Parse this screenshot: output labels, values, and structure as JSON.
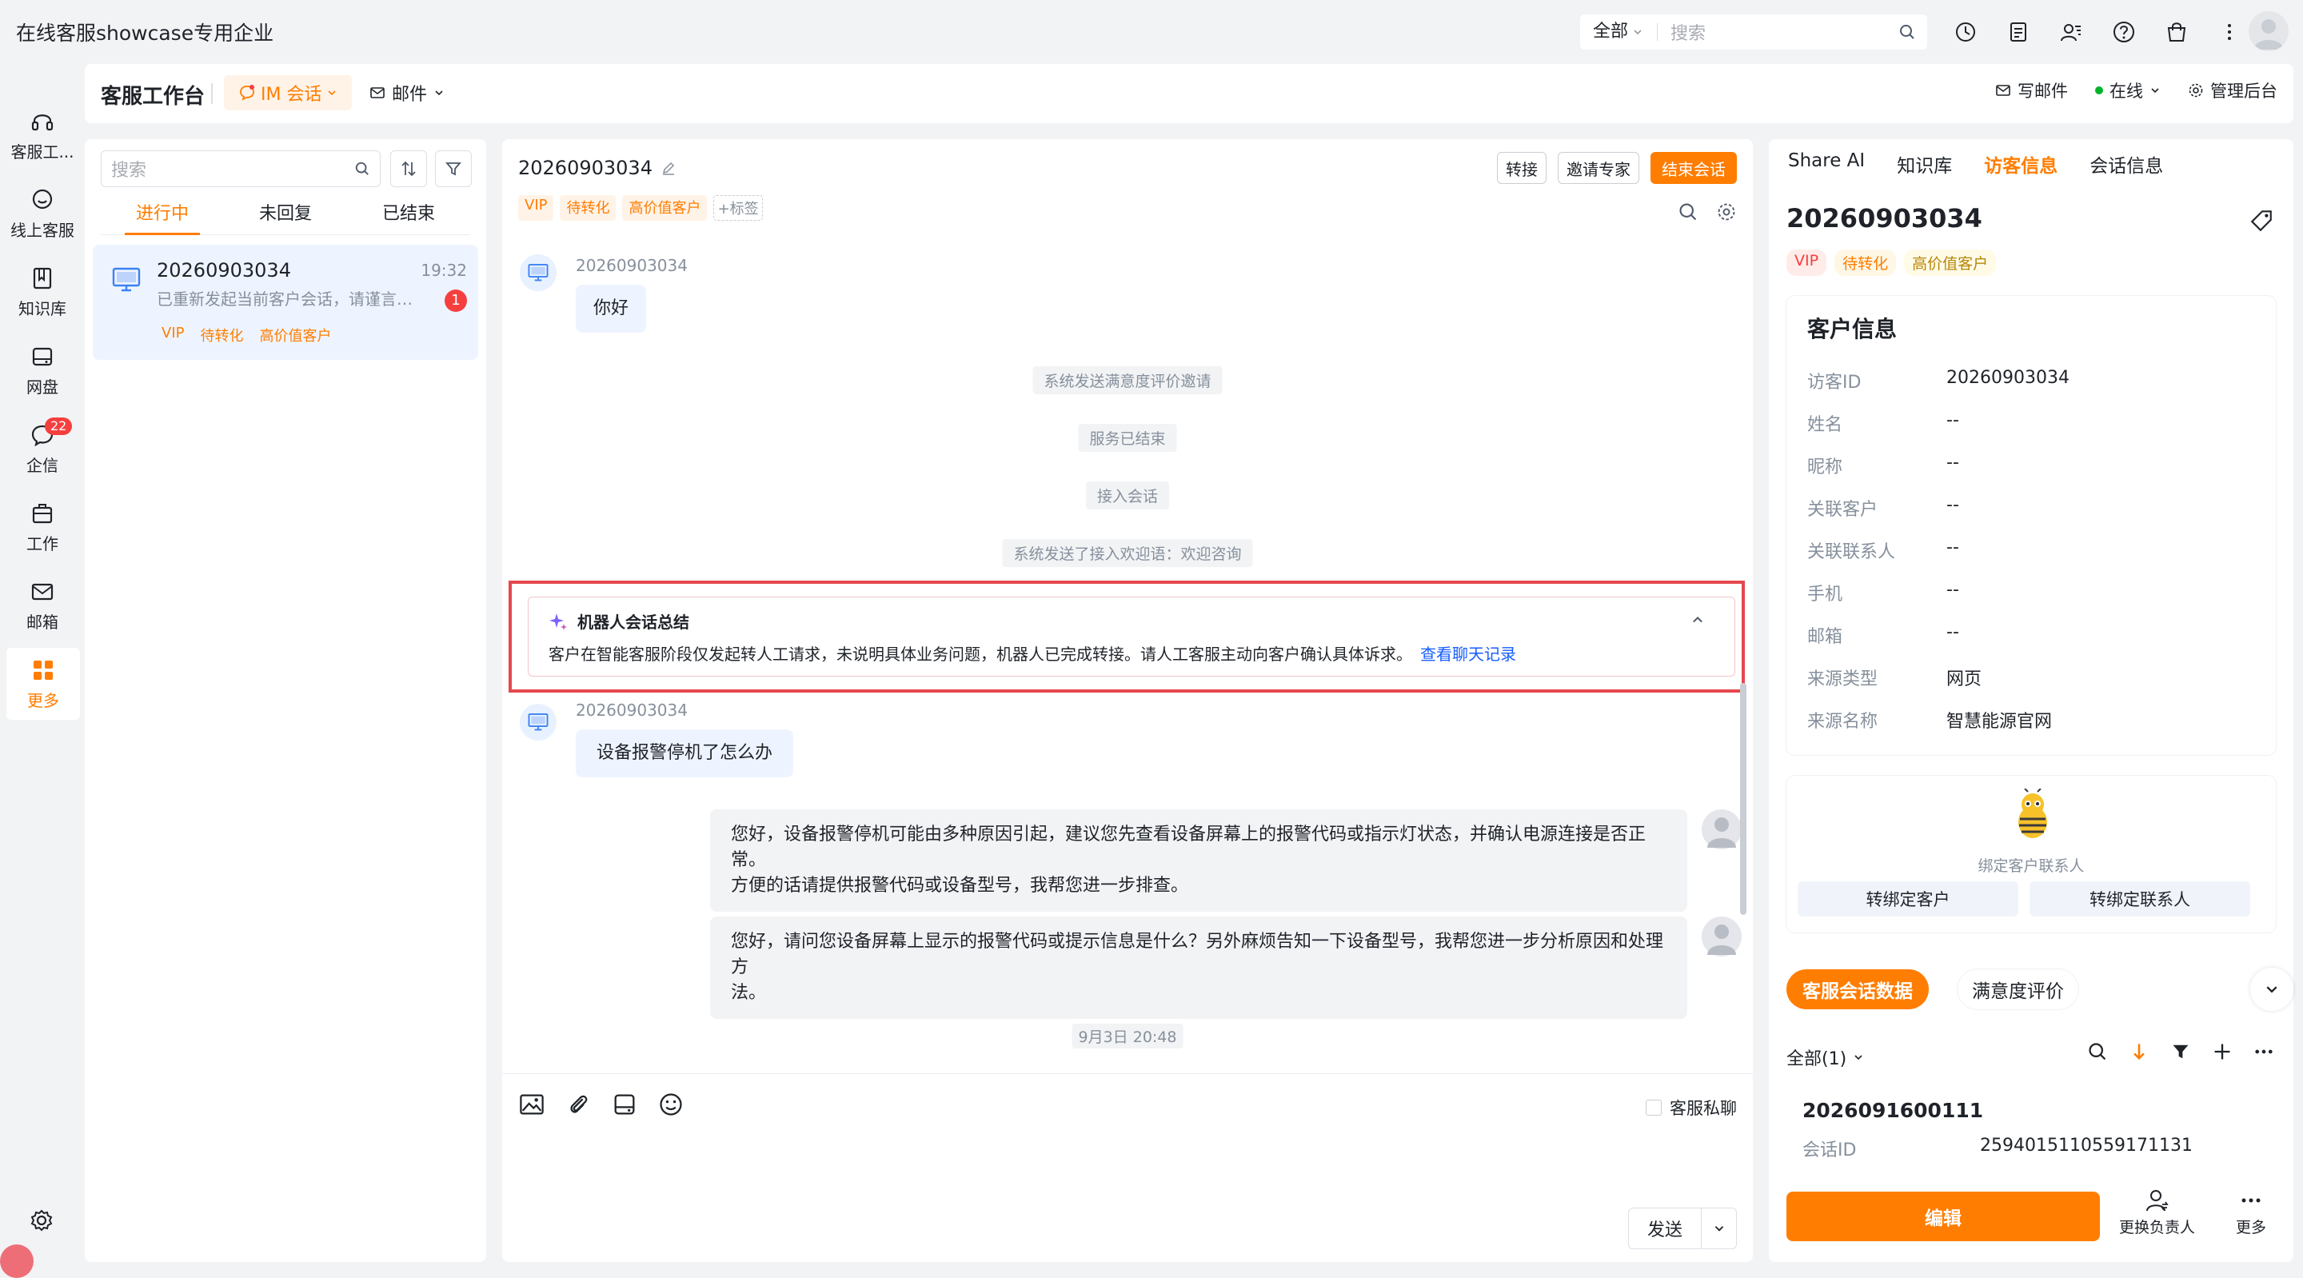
{
  "topbar": {
    "org_name": "在线客服showcase专用企业",
    "search_scope": "全部",
    "search_placeholder": "搜索"
  },
  "rail": {
    "items": [
      {
        "label": "客服工...",
        "icon": "headset-icon"
      },
      {
        "label": "线上客服",
        "icon": "chat-bubble-icon"
      },
      {
        "label": "知识库",
        "icon": "book-icon"
      },
      {
        "label": "网盘",
        "icon": "disk-icon"
      },
      {
        "label": "企信",
        "icon": "message-icon",
        "badge": "22"
      },
      {
        "label": "工作",
        "icon": "briefcase-icon"
      },
      {
        "label": "邮箱",
        "icon": "mail-icon"
      },
      {
        "label": "更多",
        "icon": "grid-icon"
      }
    ]
  },
  "header": {
    "title": "客服工作台",
    "im_tab": "IM 会话",
    "mail_tab": "邮件",
    "write_mail": "写邮件",
    "status": "在线",
    "admin": "管理后台"
  },
  "list": {
    "search_placeholder": "搜索",
    "tabs": [
      "进行中",
      "未回复",
      "已结束"
    ],
    "conversation": {
      "id": "20260903034",
      "time": "19:32",
      "preview": "已重新发起当前客户会话，请谨言慎行",
      "unread": "1",
      "tags": [
        "VIP",
        "待转化",
        "高价值客户"
      ]
    }
  },
  "chat": {
    "visitor_id": "20260903034",
    "tags": [
      "VIP",
      "待转化",
      "高价值客户"
    ],
    "add_tag": "+标签",
    "actions": {
      "transfer": "转接",
      "invite": "邀请专家",
      "end": "结束会话"
    },
    "messages": {
      "m1_sender": "20260903034",
      "m1_text": "你好",
      "sys1": "系统发送满意度评价邀请",
      "sys2": "服务已结束",
      "sys3": "接入会话",
      "sys4": "系统发送了接入欢迎语：欢迎咨询",
      "m2_sender": "20260903034",
      "m2_text": "设备报警停机了怎么办",
      "a1_line1": "您好，设备报警停机可能由多种原因引起，建议您先查看设备屏幕上的报警代码或指示灯状态，并确认电源连接是否正常。",
      "a1_line2": "方便的话请提供报警代码或设备型号，我帮您进一步排查。",
      "a2_line1": "您好，请问您设备屏幕上显示的报警代码或提示信息是什么？另外麻烦告知一下设备型号，我帮您进一步分析原因和处理方",
      "a2_line2": "法。",
      "time_divider": "9月3日 20:48"
    },
    "robot_summary": {
      "title": "机器人会话总结",
      "text": "客户在智能客服阶段仅发起转人工请求，未说明具体业务问题，机器人已完成转接。请人工客服主动向客户确认具体诉求。",
      "link": "查看聊天记录"
    },
    "private_label": "客服私聊",
    "send_label": "发送"
  },
  "right": {
    "tabs": [
      "Share AI",
      "知识库",
      "访客信息",
      "会话信息"
    ],
    "visitor_id": "20260903034",
    "tags": [
      "VIP",
      "待转化",
      "高价值客户"
    ],
    "customer_info": {
      "title": "客户信息",
      "rows": [
        {
          "label": "访客ID",
          "value": "20260903034"
        },
        {
          "label": "姓名",
          "value": "--"
        },
        {
          "label": "昵称",
          "value": "--"
        },
        {
          "label": "关联客户",
          "value": "--"
        },
        {
          "label": "关联联系人",
          "value": "--"
        },
        {
          "label": "手机",
          "value": "--"
        },
        {
          "label": "邮箱",
          "value": "--"
        },
        {
          "label": "来源类型",
          "value": "网页"
        },
        {
          "label": "来源名称",
          "value": "智慧能源官网"
        }
      ]
    },
    "bind": {
      "text": "绑定客户联系人",
      "to_customer": "转绑定客户",
      "to_contact": "转绑定联系人"
    },
    "stats_tabs": [
      "客服会话数据",
      "满意度评价"
    ],
    "filter_all": "全部(1)",
    "session": {
      "id": "2026091600111",
      "label": "会话ID",
      "value": "2594015110559171131"
    },
    "edit": "编辑",
    "change_owner": "更换负责人",
    "more": "更多"
  },
  "colors": {
    "accent": "#ff7d00",
    "link": "#165dff",
    "danger": "#f53f3f",
    "highlight_border": "#e5484d"
  }
}
